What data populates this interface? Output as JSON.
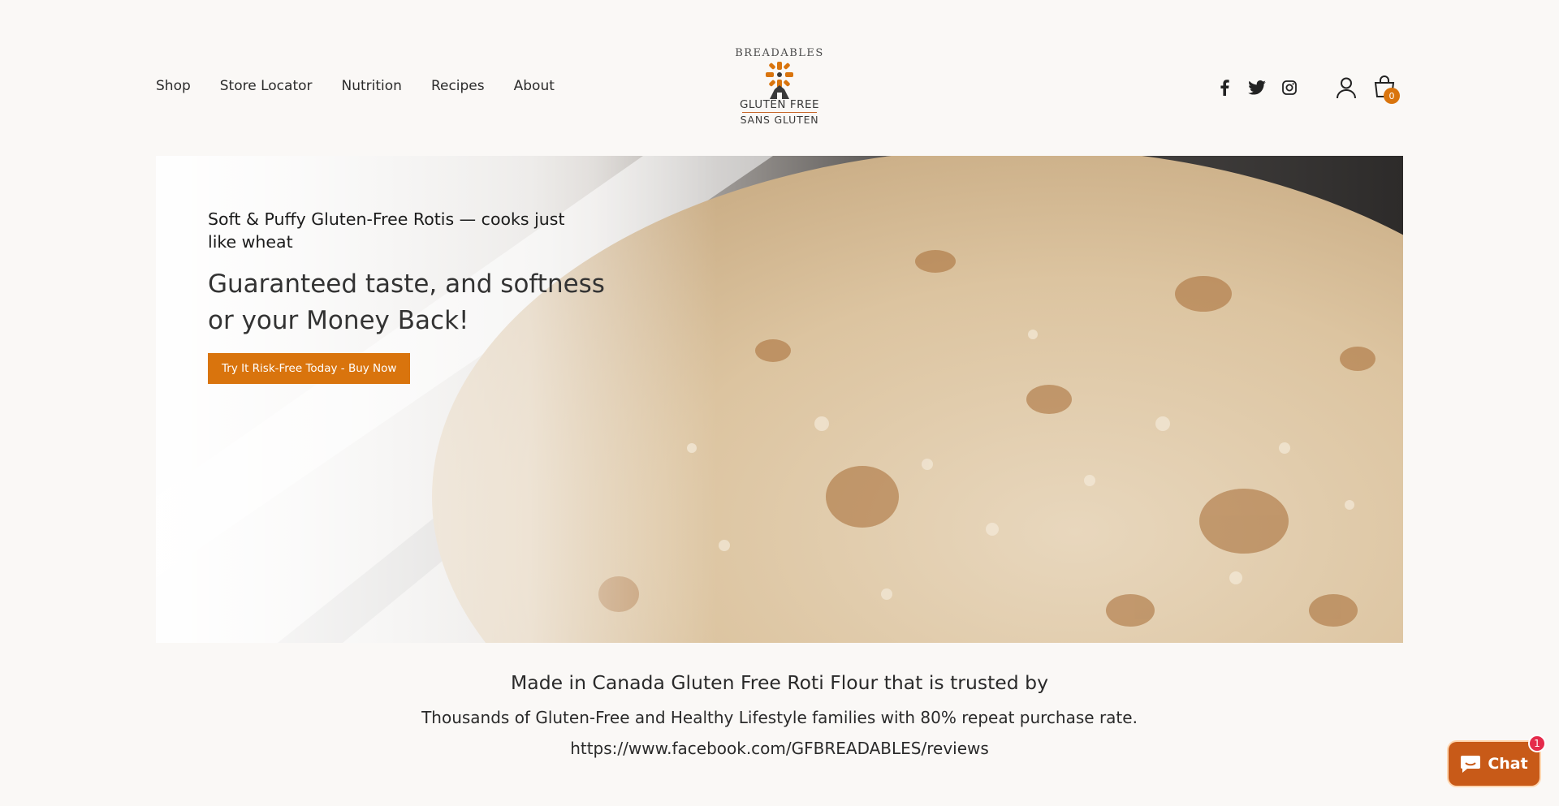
{
  "nav": {
    "items": [
      {
        "label": "Shop"
      },
      {
        "label": "Store Locator"
      },
      {
        "label": "Nutrition"
      },
      {
        "label": "Recipes"
      },
      {
        "label": "About"
      }
    ]
  },
  "logo": {
    "top": "BREADABLES",
    "line1": "GLUTEN FREE",
    "line2": "SANS GLUTEN"
  },
  "social": [
    "facebook-icon",
    "twitter-icon",
    "instagram-icon"
  ],
  "header_icons": {
    "account": "account-icon",
    "cart": "cart-icon",
    "cart_count": "0"
  },
  "hero": {
    "subtitle": "Soft & Puffy Gluten-Free Rotis — cooks just like wheat",
    "title": "Guaranteed taste, and softness or your Money Back!",
    "button_label": "Try It Risk-Free Today - Buy Now"
  },
  "trust": {
    "title": "Made in Canada Gluten Free Roti Flour that is trusted by",
    "line": "Thousands of Gluten-Free and Healthy Lifestyle families with 80% repeat purchase rate.",
    "link": "https://www.facebook.com/GFBREADABLES/reviews"
  },
  "chat": {
    "label": "Chat",
    "badge": "1"
  },
  "colors": {
    "accent": "#d9740d",
    "background": "#faf8f6",
    "chat": "#c85a18"
  }
}
